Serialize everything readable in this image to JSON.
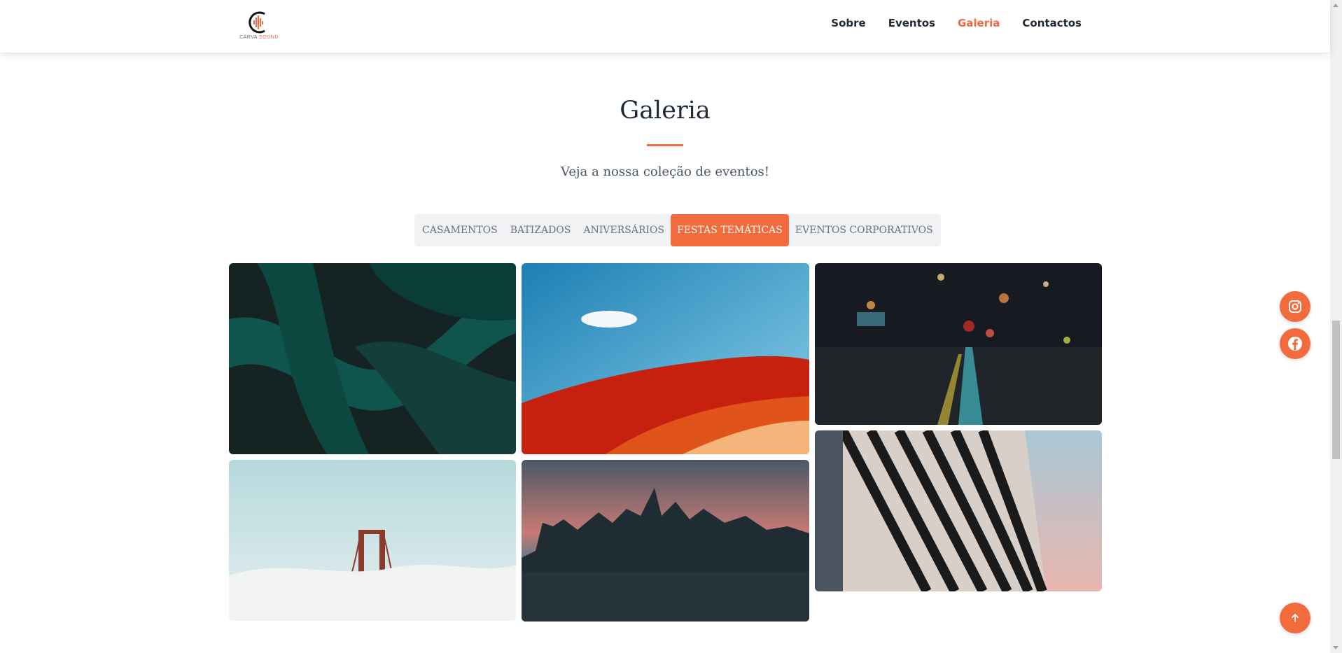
{
  "brand": {
    "name_part1": "CARVA",
    "name_part2": " SOUND",
    "accent_color": "#f36a3c"
  },
  "nav": {
    "items": [
      {
        "label": "Sobre",
        "active": false
      },
      {
        "label": "Eventos",
        "active": false
      },
      {
        "label": "Galeria",
        "active": true
      },
      {
        "label": "Contactos",
        "active": false
      }
    ]
  },
  "section": {
    "title": "Galeria",
    "subtitle": "Veja a nossa coleção de eventos!"
  },
  "tabs": [
    {
      "label": "CASAMENTOS",
      "active": false
    },
    {
      "label": "BATIZADOS",
      "active": false
    },
    {
      "label": "ANIVERSÁRIOS",
      "active": false
    },
    {
      "label": "FESTAS TEMÁTICAS",
      "active": true
    },
    {
      "label": "EVENTOS CORPORATIVOS",
      "active": false
    }
  ],
  "gallery": [
    {
      "subject": "green leaf abstract"
    },
    {
      "subject": "red desert dunes with blue sky"
    },
    {
      "subject": "city street at night bokeh"
    },
    {
      "subject": "bridge tower above fog"
    },
    {
      "subject": "city skyline at dusk"
    },
    {
      "subject": "building balconies against sky"
    }
  ],
  "floating": {
    "social": [
      "instagram-icon",
      "facebook-icon"
    ],
    "back_to_top": "arrow-up-icon"
  }
}
